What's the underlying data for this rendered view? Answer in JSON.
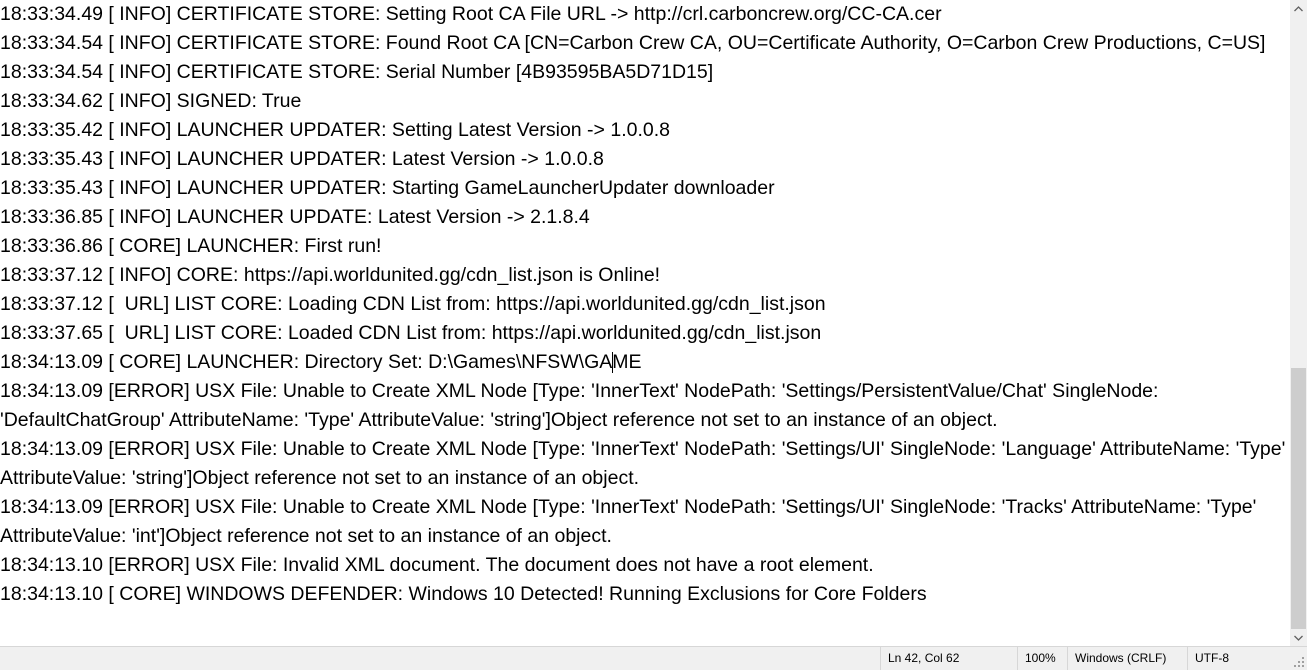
{
  "editor": {
    "lines": [
      "18:33:34.49 [ INFO] CERTIFICATE STORE: Setting Root CA File URL -> http://crl.carboncrew.org/CC-CA.cer",
      "18:33:34.54 [ INFO] CERTIFICATE STORE: Found Root CA [CN=Carbon Crew CA, OU=Certificate Authority, O=Carbon Crew Productions, C=US]",
      "18:33:34.54 [ INFO] CERTIFICATE STORE: Serial Number [4B93595BA5D71D15]",
      "18:33:34.62 [ INFO] SIGNED: True",
      "18:33:35.42 [ INFO] LAUNCHER UPDATER: Setting Latest Version -> 1.0.0.8",
      "18:33:35.43 [ INFO] LAUNCHER UPDATER: Latest Version -> 1.0.0.8",
      "18:33:35.43 [ INFO] LAUNCHER UPDATER: Starting GameLauncherUpdater downloader",
      "18:33:36.85 [ INFO] LAUNCHER UPDATE: Latest Version -> 2.1.8.4",
      "18:33:36.86 [ CORE] LAUNCHER: First run!",
      "18:33:37.12 [ INFO] CORE: https://api.worldunited.gg/cdn_list.json is Online!",
      "18:33:37.12 [  URL] LIST CORE: Loading CDN List from: https://api.worldunited.gg/cdn_list.json",
      "18:33:37.65 [  URL] LIST CORE: Loaded CDN List from: https://api.worldunited.gg/cdn_list.json",
      "18:34:13.09 [ CORE] LAUNCHER: Directory Set: D:\\Games\\NFSW\\GAME",
      "18:34:13.09 [ERROR] USX File: Unable to Create XML Node [Type: 'InnerText' NodePath: 'Settings/PersistentValue/Chat' SingleNode:",
      "'DefaultChatGroup' AttributeName: 'Type' AttributeValue: 'string']Object reference not set to an instance of an object.",
      "18:34:13.09 [ERROR] USX File: Unable to Create XML Node [Type: 'InnerText' NodePath: 'Settings/UI' SingleNode: 'Language' AttributeName: 'Type'",
      "AttributeValue: 'string']Object reference not set to an instance of an object.",
      "18:34:13.09 [ERROR] USX File: Unable to Create XML Node [Type: 'InnerText' NodePath: 'Settings/UI' SingleNode: 'Tracks' AttributeName: 'Type'",
      "AttributeValue: 'int']Object reference not set to an instance of an object.",
      "18:34:13.10 [ERROR] USX File: Invalid XML document. The document does not have a root element.",
      "18:34:13.10 [ CORE] WINDOWS DEFENDER: Windows 10 Detected! Running Exclusions for Core Folders"
    ],
    "caret_line": 12,
    "caret_after_text": "18:34:13.09 [ CORE] LAUNCHER: Directory Set: D:\\Games\\NFSW\\GA"
  },
  "statusbar": {
    "position": "Ln 42, Col 62",
    "zoom": "100%",
    "line_ending": "Windows (CRLF)",
    "encoding": "UTF-8"
  },
  "icons": {
    "scroll_up": "chevron-up-icon",
    "scroll_down": "chevron-down-icon",
    "resize_grip": "resize-grip-icon"
  },
  "colors": {
    "text": "#000000",
    "background": "#ffffff",
    "chrome": "#f0f0f0",
    "scroll_thumb": "#cdcdcd"
  }
}
